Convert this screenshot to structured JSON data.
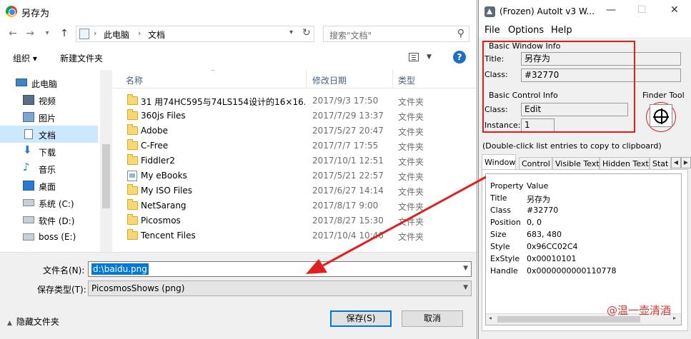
{
  "dialog": {
    "title": "另存为",
    "nav": {
      "back": "←",
      "forward": "→",
      "recent": "▾",
      "up": "↑"
    },
    "address": {
      "crumbs": [
        "此电脑",
        "文档"
      ],
      "separator": "›"
    },
    "search_placeholder": "搜索\"文档\"",
    "toolbar": {
      "organize": "组织 ▾",
      "new_folder": "新建文件夹",
      "help": "?"
    },
    "navpane": [
      {
        "label": "此电脑",
        "icon": "computer-icon",
        "selected": false
      },
      {
        "label": "视频",
        "icon": "video-icon",
        "selected": false
      },
      {
        "label": "图片",
        "icon": "picture-icon",
        "selected": false
      },
      {
        "label": "文档",
        "icon": "document-icon",
        "selected": true
      },
      {
        "label": "下载",
        "icon": "download-icon",
        "selected": false
      },
      {
        "label": "音乐",
        "icon": "music-icon",
        "selected": false
      },
      {
        "label": "桌面",
        "icon": "desktop-icon",
        "selected": false
      },
      {
        "label": "系统 (C:)",
        "icon": "drive-icon",
        "selected": false
      },
      {
        "label": "软件 (D:)",
        "icon": "drive-icon",
        "selected": false
      },
      {
        "label": "boss (E:)",
        "icon": "drive-icon",
        "selected": false
      }
    ],
    "columns": {
      "name": "名称",
      "date": "修改日期",
      "type": "类型"
    },
    "files": [
      {
        "name": "31 用74HC595与74LS154设计的16×16...",
        "date": "2017/9/3 17:50",
        "type": "文件夹",
        "icon": "folder-icon"
      },
      {
        "name": "360js Files",
        "date": "2017/7/29 13:37",
        "type": "文件夹",
        "icon": "folder-icon"
      },
      {
        "name": "Adobe",
        "date": "2017/5/27 20:47",
        "type": "文件夹",
        "icon": "folder-icon"
      },
      {
        "name": "C-Free",
        "date": "2017/7/7 17:55",
        "type": "文件夹",
        "icon": "folder-icon"
      },
      {
        "name": "Fiddler2",
        "date": "2017/10/1 12:51",
        "type": "文件夹",
        "icon": "folder-icon"
      },
      {
        "name": "My eBooks",
        "date": "2017/5/21 22:57",
        "type": "文件夹",
        "icon": "ebook-folder-icon"
      },
      {
        "name": "My ISO Files",
        "date": "2017/6/27 14:14",
        "type": "文件夹",
        "icon": "folder-icon"
      },
      {
        "name": "NetSarang",
        "date": "2017/8/17 9:00",
        "type": "文件夹",
        "icon": "folder-icon"
      },
      {
        "name": "Picosmos",
        "date": "2017/8/27 15:30",
        "type": "文件夹",
        "icon": "folder-icon"
      },
      {
        "name": "Tencent Files",
        "date": "2017/10/4 10:46",
        "type": "文件夹",
        "icon": "folder-icon"
      }
    ],
    "filename_label": "文件名(N):",
    "filename_value": "d:\\baidu.png",
    "filetype_label": "保存类型(T):",
    "filetype_value": "PicosmosShows (png)",
    "hide_folders": "隐藏文件夹",
    "save_button": "保存(S)",
    "cancel_button": "取消"
  },
  "autoit": {
    "title": "(Frozen) AutoIt v3 W...",
    "window_controls": {
      "minimize": "—",
      "maximize": "☐",
      "close": "✕"
    },
    "menu": [
      "File",
      "Options",
      "Help"
    ],
    "basic_window_info": "Basic Window Info",
    "title_label": "Title:",
    "title_value": "另存为",
    "class_label": "Class:",
    "class_value": "#32770",
    "basic_control_info": "Basic Control Info",
    "control_class_label": "Class:",
    "control_class_value": "Edit",
    "instance_label": "Instance:",
    "instance_value": "1",
    "finder_tool": "Finder Tool",
    "hint": "(Double-click list entries to copy to clipboard)",
    "tabs": [
      "Window",
      "Control",
      "Visible Text",
      "Hidden Text",
      "Stat"
    ],
    "tab_scroll": {
      "left": "◀",
      "right": "▶"
    },
    "properties": [
      {
        "k": "Property",
        "v": "Value"
      },
      {
        "k": "Title",
        "v": "另存为"
      },
      {
        "k": "Class",
        "v": "#32770"
      },
      {
        "k": "Position",
        "v": "0, 0"
      },
      {
        "k": "Size",
        "v": "683, 480"
      },
      {
        "k": "Style",
        "v": "0x96CC02C4"
      },
      {
        "k": "ExStyle",
        "v": "0x00010101"
      },
      {
        "k": "Handle",
        "v": "0x0000000000110778"
      }
    ],
    "scroll_arrows": {
      "left": "◂",
      "right": "▸"
    }
  },
  "watermark": "@温一壶清酒",
  "colors": {
    "annotation_red": "#e02020",
    "selection_blue": "#0078d7",
    "nav_selected": "#cce8ff"
  }
}
